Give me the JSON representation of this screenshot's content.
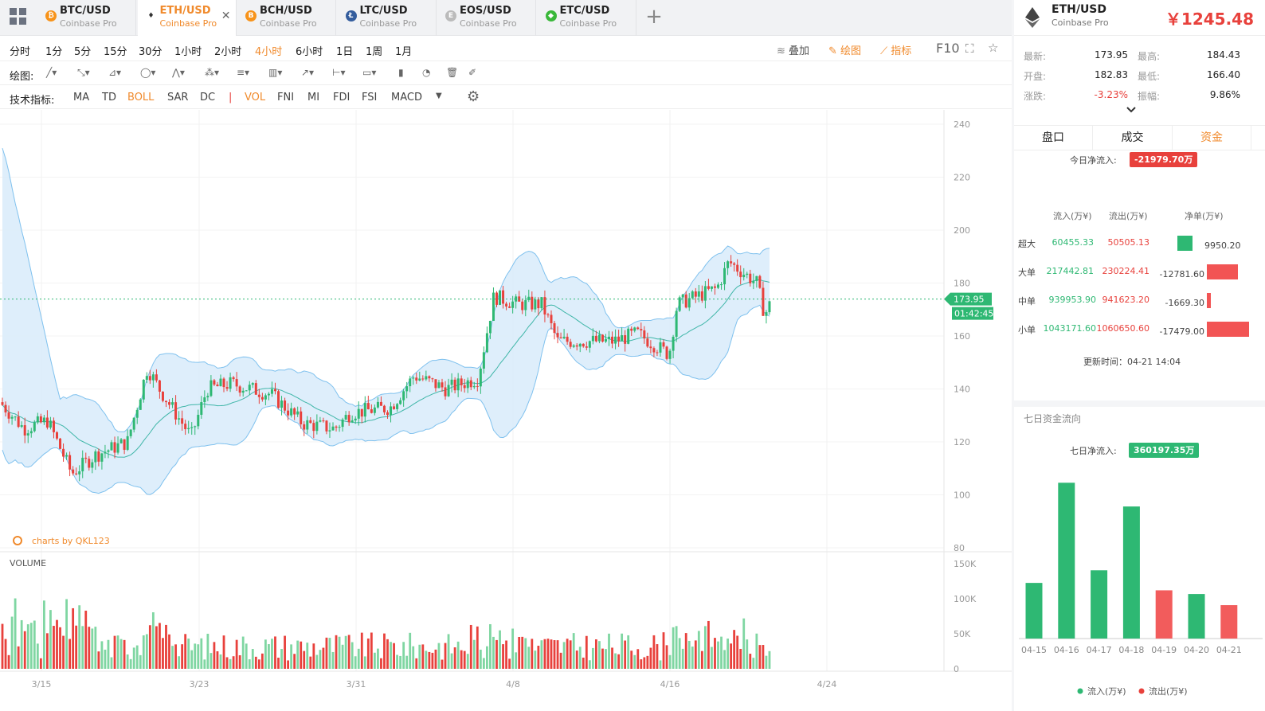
{
  "tabs": [
    {
      "symbol": "BTC/USD",
      "exchange": "Coinbase Pro",
      "coin_letter": "₿",
      "color": "#f7931a",
      "active": false
    },
    {
      "symbol": "ETH/USD",
      "exchange": "Coinbase Pro",
      "coin_letter": "♦",
      "color": "#ffffff",
      "active": true
    },
    {
      "symbol": "BCH/USD",
      "exchange": "Coinbase Pro",
      "coin_letter": "B",
      "color": "#f7931a",
      "active": false
    },
    {
      "symbol": "LTC/USD",
      "exchange": "Coinbase Pro",
      "coin_letter": "Ł",
      "color": "#345d9d",
      "active": false
    },
    {
      "symbol": "EOS/USD",
      "exchange": "Coinbase Pro",
      "coin_letter": "E",
      "color": "#bbbbbb",
      "active": false
    },
    {
      "symbol": "ETC/USD",
      "exchange": "Coinbase Pro",
      "coin_letter": "◆",
      "color": "#3ab83a",
      "active": false
    }
  ],
  "periods": [
    "分时",
    "1分",
    "5分",
    "15分",
    "30分",
    "1小时",
    "2小时",
    "4小时",
    "6小时",
    "1日",
    "1周",
    "1月"
  ],
  "active_period": "4小时",
  "toolbar_right": {
    "overlay": "叠加",
    "draw": "绘图",
    "indicator": "指标",
    "f10": "F10"
  },
  "drawing_label": "绘图:",
  "indicators_label": "技术指标:",
  "indicators": [
    "MA",
    "TD",
    "BOLL",
    "SAR",
    "DC",
    "|",
    "VOL",
    "FNI",
    "MI",
    "FDI",
    "FSI",
    "MACD"
  ],
  "active_indicators": [
    "BOLL",
    "VOL"
  ],
  "chart_data": {
    "type": "candlestick",
    "price_axis": [
      "240",
      "220",
      "200",
      "180",
      "160",
      "140",
      "120",
      "100",
      "80"
    ],
    "ylim": [
      80,
      240
    ],
    "volume_axis": [
      "150K",
      "100K",
      "50K",
      "0"
    ],
    "volume_ylim": [
      0,
      150000
    ],
    "x_ticks": [
      "3/15",
      "3/23",
      "3/31",
      "4/8",
      "4/16",
      "4/24"
    ],
    "last_price": "173.95",
    "countdown": "01:42:45",
    "volume_label": "VOLUME",
    "watermark": "charts by QKL123",
    "colors": {
      "up": "#2eb873",
      "down": "#e8413c",
      "band": "#d8ebfa",
      "band_line": "#7fc1ee",
      "mid": "#3fb6a8"
    }
  },
  "right": {
    "symbol": "ETH/USD",
    "exchange": "Coinbase Pro",
    "price": "￥1245.48",
    "stats": [
      {
        "k": "最新:",
        "v": "173.95",
        "k2": "最高:",
        "v2": "184.43"
      },
      {
        "k": "开盘:",
        "v": "182.83",
        "k2": "最低:",
        "v2": "166.40"
      },
      {
        "k": "涨跌:",
        "v": "-3.23%",
        "k2": "振幅:",
        "v2": "9.86%"
      }
    ],
    "tabs": [
      "盘口",
      "成交",
      "资金"
    ],
    "active_tab": "资金",
    "today_label": "今日净流入:",
    "today_value": "-21979.70万",
    "flow_headers": [
      "流入(万¥)",
      "流出(万¥)",
      "净单(万¥)"
    ],
    "flows": [
      {
        "name": "超大",
        "in": "60455.33",
        "out": "50505.13",
        "net": "9950.20",
        "net_val": 9950.2
      },
      {
        "name": "大单",
        "in": "217442.81",
        "out": "230224.41",
        "net": "-12781.60",
        "net_val": -12781.6
      },
      {
        "name": "中单",
        "in": "939953.90",
        "out": "941623.20",
        "net": "-1669.30",
        "net_val": -1669.3
      },
      {
        "name": "小单",
        "in": "1043171.60",
        "out": "1060650.60",
        "net": "-17479.00",
        "net_val": -17479.0
      }
    ],
    "update_time": "更新时间：04-21 14:04",
    "seven_day_title": "七日资金流向",
    "seven_day_label": "七日净流入:",
    "seven_day_value": "360197.35万",
    "seven_day_chart": {
      "type": "bar",
      "categories": [
        "04-15",
        "04-16",
        "04-17",
        "04-18",
        "04-19",
        "04-20",
        "04-21"
      ],
      "values": [
        75,
        210,
        92,
        178,
        65,
        60,
        45
      ],
      "signs": [
        "in",
        "in",
        "in",
        "in",
        "out",
        "in",
        "out"
      ]
    },
    "legend_in": "流入(万¥)",
    "legend_out": "流出(万¥)"
  }
}
